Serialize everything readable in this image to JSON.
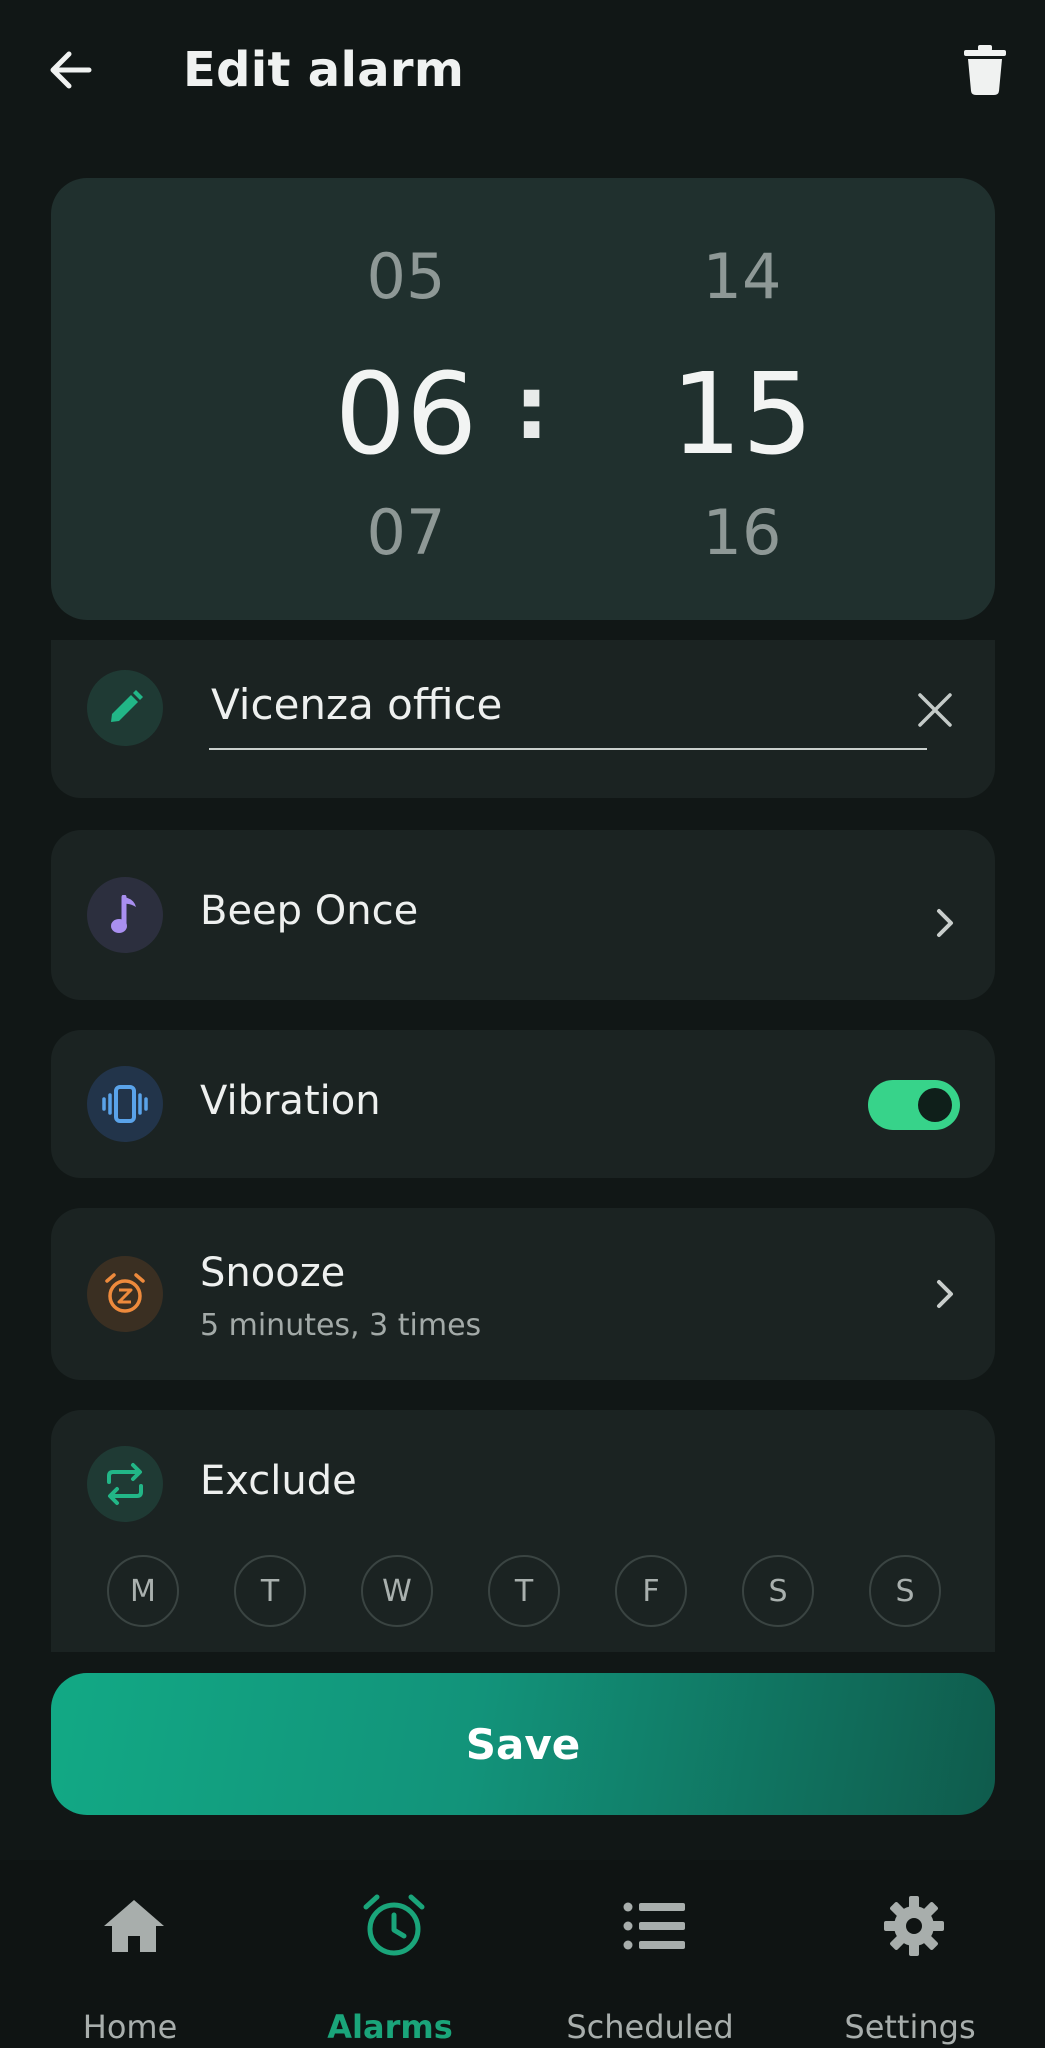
{
  "header": {
    "title": "Edit alarm",
    "back_icon": "arrow-left-icon",
    "delete_icon": "trash-icon"
  },
  "time_picker": {
    "hour_prev": "05",
    "hour": "06",
    "hour_next": "07",
    "separator": ":",
    "minute_prev": "14",
    "minute": "15",
    "minute_next": "16"
  },
  "label_field": {
    "value": "Vicenza office",
    "icon": "pencil-icon",
    "clear_icon": "close-icon"
  },
  "sound": {
    "label": "Beep Once",
    "icon": "music-note-icon"
  },
  "vibration": {
    "label": "Vibration",
    "icon": "vibration-icon",
    "enabled": true
  },
  "snooze": {
    "label": "Snooze",
    "detail": "5 minutes, 3 times",
    "icon": "snooze-icon"
  },
  "exclude": {
    "label": "Exclude",
    "icon": "repeat-icon",
    "days": [
      "M",
      "T",
      "W",
      "T",
      "F",
      "S",
      "S"
    ]
  },
  "save_label": "Save",
  "nav": {
    "items": [
      {
        "label": "Home",
        "icon": "home-icon"
      },
      {
        "label": "Alarms",
        "icon": "alarm-clock-icon",
        "active": true
      },
      {
        "label": "Scheduled",
        "icon": "list-icon"
      },
      {
        "label": "Settings",
        "icon": "gear-icon"
      }
    ]
  },
  "colors": {
    "background": "#111716",
    "accent": "#1aa57a",
    "toggle_on": "#37d38a",
    "card": "#1b2322",
    "time_card": "#20302e"
  }
}
